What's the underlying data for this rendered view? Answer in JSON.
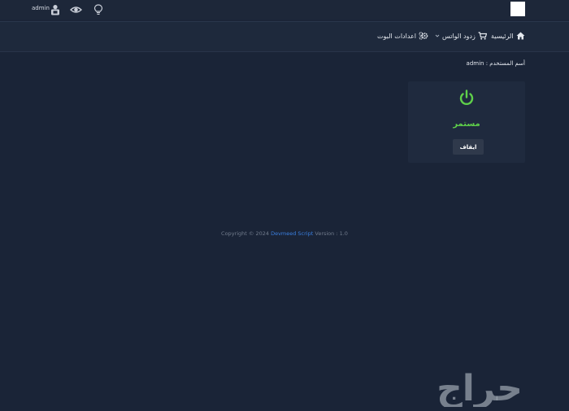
{
  "topbar": {
    "username": "admin"
  },
  "nav": {
    "home_label": "الرئيسية",
    "bots_label": "زدود الواتس",
    "settings_label": "اعدادات البوت"
  },
  "user_info": {
    "label": "أسم المستخدم :",
    "value": "admin"
  },
  "bot_card": {
    "status_text": "مستمر",
    "stop_button_label": "ايقاف"
  },
  "footer": {
    "prefix": "Copyright © 2024",
    "brand": "Devmeed Script",
    "suffix": "Version : 1.0"
  },
  "watermark": {
    "text": "حراج"
  },
  "colors": {
    "accent_green": "#5fd04a",
    "link_blue": "#3a7fe0",
    "background": "#1b2538"
  }
}
